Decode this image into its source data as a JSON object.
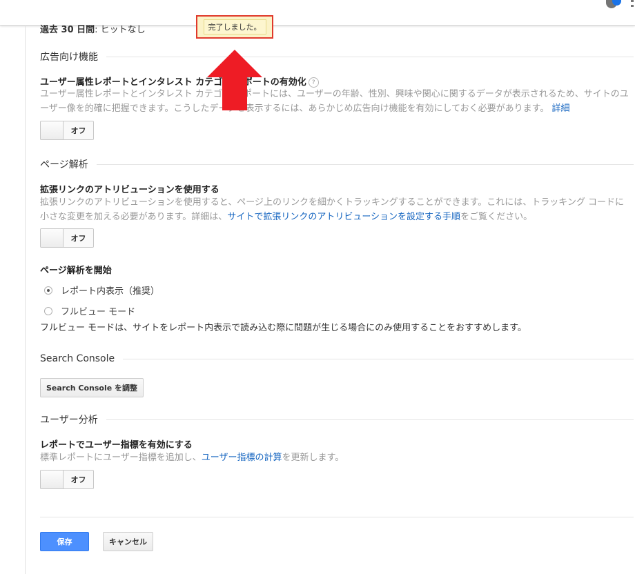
{
  "header": {
    "notification_icon": "bell-icon",
    "menu_icon": "kebab-icon"
  },
  "toast": {
    "message": "完了しました。"
  },
  "truncated_line": {
    "prefix": "過去 30 日間",
    "value": ": ヒットなし"
  },
  "advertising": {
    "section_title": "広告向け機能",
    "setting_title": "ユーザー属性レポートとインタレスト カテゴリ レポートの有効化",
    "help_glyph": "?",
    "desc_line1": "ユーザー属性レポートとインタレスト カテゴリ レポートには、ユーザーの年齢、性別、興味や関心に関するデータが表示されるため、サイトのユ",
    "desc_line2": "ーザー像を的確に把握できます。こうしたデータを表示するには、あらかじめ広告向け機能を有効にしておく必要があります。",
    "desc_link": "詳細",
    "toggle_label": "オフ"
  },
  "page_analytics": {
    "section_title": "ページ解析",
    "setting_title": "拡張リンクのアトリビューションを使用する",
    "desc_line1": "拡張リンクのアトリビューションを使用すると、ページ上のリンクを細かくトラッキングすることができます。これには、トラッキング コードに",
    "desc_line2_prefix": "小さな変更を加える必要があります。詳細は、",
    "desc_link": "サイトで拡張リンクのアトリビューションを設定する手順",
    "desc_line2_suffix": "をご覧ください。",
    "toggle_label": "オフ",
    "start_title": "ページ解析を開始",
    "options": [
      {
        "label": "レポート内表示（推奨）",
        "selected": true
      },
      {
        "label": "フルビュー モード",
        "selected": false
      }
    ],
    "note": "フルビュー モードは、サイトをレポート内表示で読み込む際に問題が生じる場合にのみ使用することをおすすめします。"
  },
  "search_console": {
    "section_title": "Search Console",
    "button_label": "Search Console を調整"
  },
  "user_analysis": {
    "section_title": "ユーザー分析",
    "setting_title": "レポートでユーザー指標を有効にする",
    "desc_prefix": "標準レポートにユーザー指標を追加し、",
    "desc_link": "ユーザー指標の計算",
    "desc_suffix": "を更新します。",
    "toggle_label": "オフ"
  },
  "footer": {
    "save_label": "保存",
    "cancel_label": "キャンセル"
  },
  "colors": {
    "accent_blue": "#4d90fe",
    "link_blue": "#1565c0",
    "annotation_red": "#e0392b",
    "toast_bg": "#fbf3c8"
  }
}
